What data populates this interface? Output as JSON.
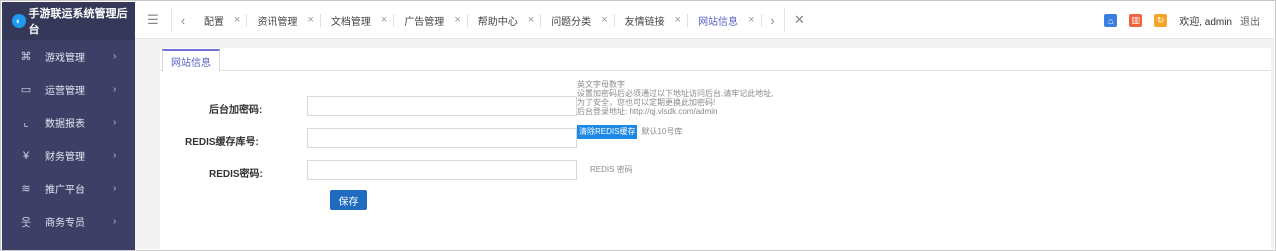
{
  "app": {
    "title": "手游联运系统管理后台"
  },
  "sidebar": {
    "items": [
      {
        "label": "游戏管理",
        "icon": "gamepad-icon"
      },
      {
        "label": "运营管理",
        "icon": "monitor-icon"
      },
      {
        "label": "数据报表",
        "icon": "line-chart-icon"
      },
      {
        "label": "财务管理",
        "icon": "yuan-icon"
      },
      {
        "label": "推广平台",
        "icon": "layers-icon"
      },
      {
        "label": "商务专员",
        "icon": "user-icon"
      }
    ]
  },
  "tabs": [
    {
      "label": "配置"
    },
    {
      "label": "资讯管理"
    },
    {
      "label": "文档管理"
    },
    {
      "label": "广告管理"
    },
    {
      "label": "帮助中心"
    },
    {
      "label": "问题分类"
    },
    {
      "label": "友情链接"
    },
    {
      "label": "网站信息"
    }
  ],
  "header": {
    "welcome": "欢迎, admin",
    "logout": "退出"
  },
  "panel": {
    "tab_label": "网站信息"
  },
  "form": {
    "admin_code_label": "后台加密码:",
    "admin_code_value": "",
    "admin_code_note_lines": [
      "英文字母数字",
      "设置加密码后必须通过以下地址访问后台,请牢记此地址,",
      "为了安全，您也可以定期更换此加密码!",
      "后台登录地址: http://qj.vlsdk.com/admin"
    ],
    "redis_db_label": "REDIS缓存库号:",
    "redis_db_value": "",
    "clear_redis_label": "清除REDIS缓存",
    "redis_db_note": "默认10号库",
    "redis_pwd_label": "REDIS密码:",
    "redis_pwd_value": "",
    "redis_pwd_note": "REDIS 密码",
    "save_label": "保存"
  },
  "colors": {
    "sidebar_bg": "#3d3f66",
    "accent": "#5b62c6",
    "primary_button": "#1e6bc0"
  }
}
